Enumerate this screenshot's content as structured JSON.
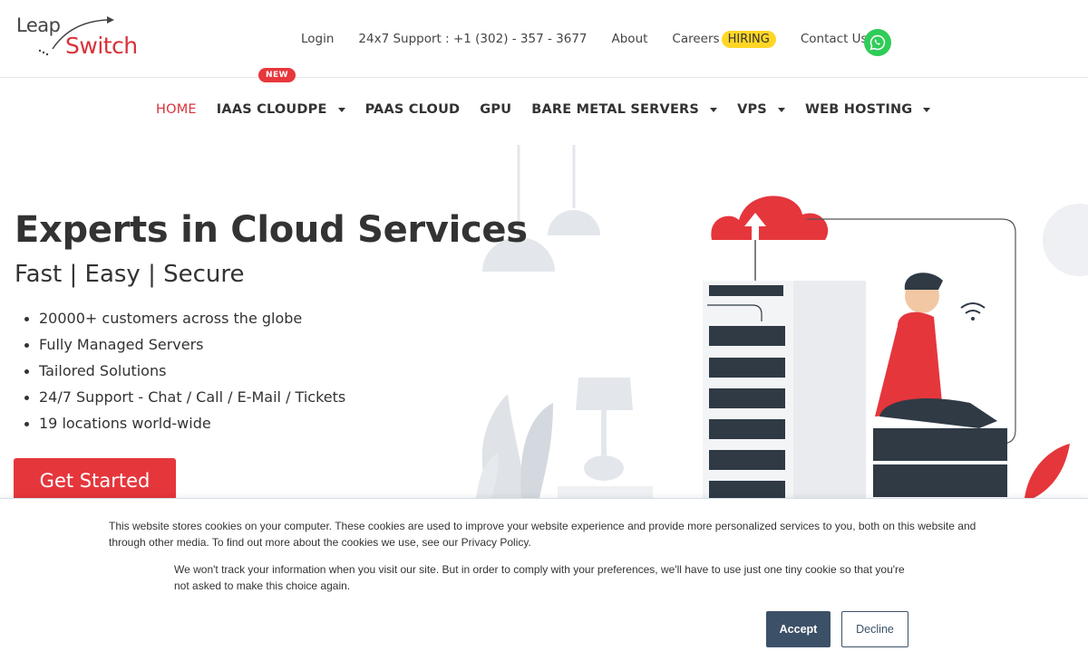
{
  "brand": {
    "logo_line1": "Leap",
    "logo_line2": "Switch",
    "accent": "#e5363c"
  },
  "toplinks": {
    "login": "Login",
    "support": "24x7 Support : +1 (302) - 357 - 3677",
    "about": "About",
    "careers": "Careers",
    "hiring_badge": "HIRING",
    "contact": "Contact Us",
    "whatsapp_icon": "whatsapp-icon"
  },
  "nav": {
    "new_badge": "NEW",
    "items": [
      {
        "label": "HOME"
      },
      {
        "label": "IAAS CLOUDPE"
      },
      {
        "label": "PAAS CLOUD"
      },
      {
        "label": "GPU"
      },
      {
        "label": "BARE METAL SERVERS"
      },
      {
        "label": "VPS"
      },
      {
        "label": "WEB HOSTING"
      }
    ]
  },
  "hero": {
    "title": "Experts in Cloud Services",
    "subtitle": "Fast | Easy | Secure",
    "bullets": [
      "20000+ customers across the globe",
      "Fully Managed Servers",
      "Tailored Solutions",
      "24/7 Support - Chat / Call / E-Mail / Tickets",
      "19 locations world-wide"
    ],
    "cta": "Get Started"
  },
  "cookie": {
    "text1": "This website stores cookies on your computer. These cookies are used to improve your website experience and provide more personalized services to you, both on this website and through other media. To find out more about the cookies we use, see our Privacy Policy.",
    "text2": "We won't track your information when you visit our site. But in order to comply with your preferences, we'll have to use just one tiny cookie so that you're not asked to make this choice again.",
    "accept": "Accept",
    "decline": "Decline"
  }
}
